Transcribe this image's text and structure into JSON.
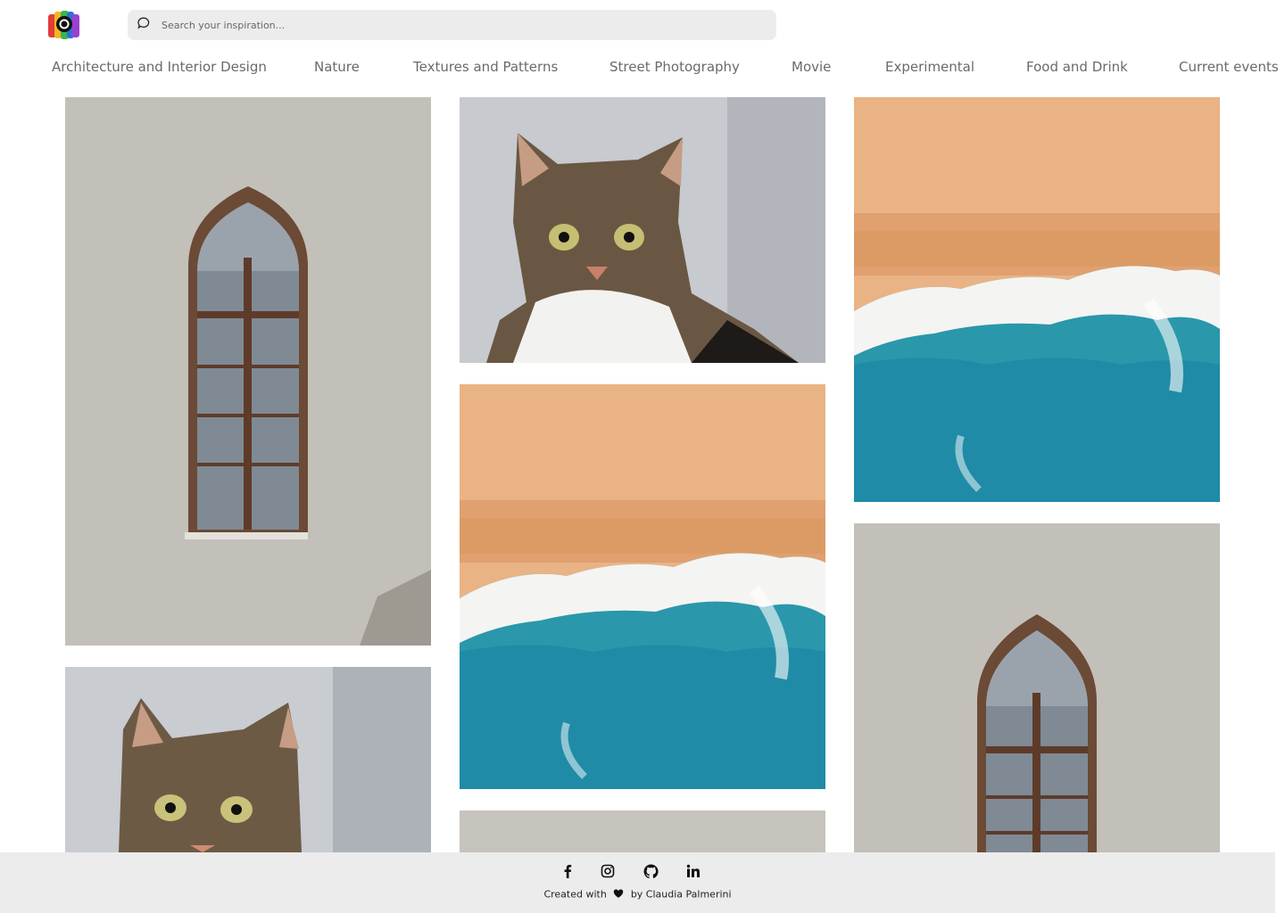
{
  "header": {
    "logo": "camera-logo-icon",
    "search": {
      "placeholder": "Search your inspiration...",
      "value": "",
      "icon": "search-bubble-icon"
    }
  },
  "nav": {
    "items": [
      {
        "label": "Architecture and Interior Design"
      },
      {
        "label": "Nature"
      },
      {
        "label": "Textures and Patterns"
      },
      {
        "label": "Street Photography"
      },
      {
        "label": "Movie"
      },
      {
        "label": "Experimental"
      },
      {
        "label": "Food and Drink"
      },
      {
        "label": "Current events"
      }
    ]
  },
  "gallery": {
    "columns": [
      [
        "window-photo",
        "cat-photo"
      ],
      [
        "cat-photo",
        "beach-photo",
        "window-photo"
      ],
      [
        "beach-photo",
        "window-photo"
      ]
    ]
  },
  "footer": {
    "icons": [
      "facebook-icon",
      "instagram-icon",
      "github-icon",
      "linkedin-icon"
    ],
    "credit_prefix": "Created with",
    "credit_suffix": "by Claudia Palmerini",
    "heart": "heart-icon"
  },
  "colors": {
    "nav_text": "#6a6a6a",
    "search_bg": "#ececec",
    "footer_bg": "#ececec",
    "wall": "#c7c4be",
    "sand": "#e8b184",
    "sea": "#1f8ea6"
  }
}
